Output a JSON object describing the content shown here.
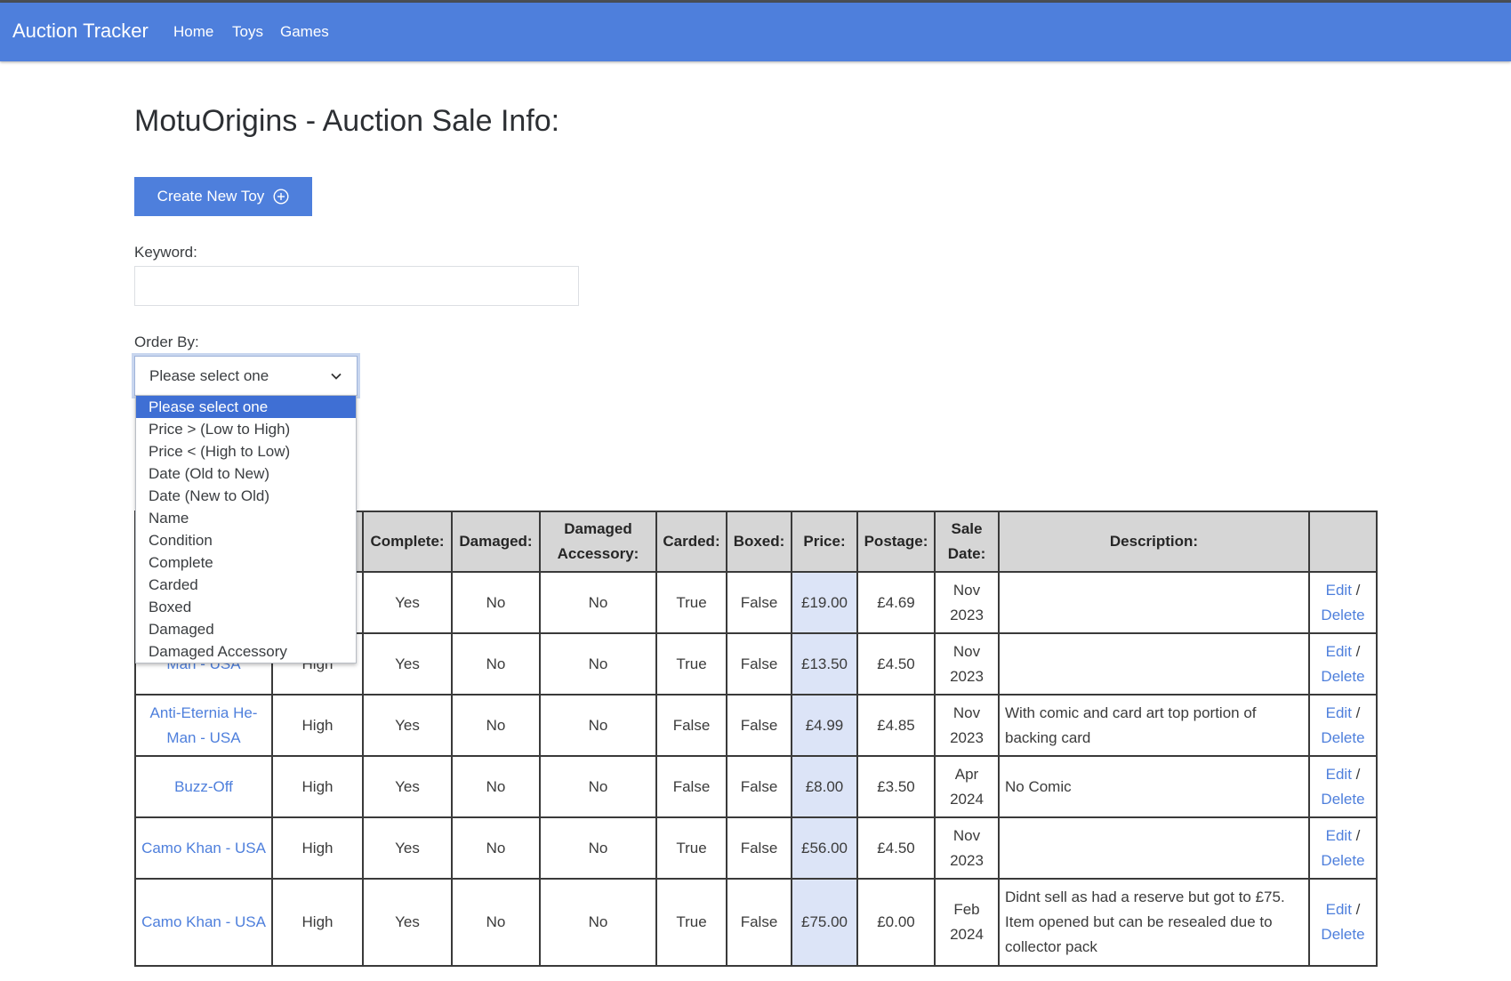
{
  "nav": {
    "brand": "Auction Tracker",
    "links": [
      "Home",
      "Toys",
      "Games"
    ]
  },
  "page": {
    "title": "MotuOrigins - Auction Sale Info:",
    "create_button": "Create New Toy",
    "keyword_label": "Keyword:",
    "keyword_value": "",
    "order_label": "Order By:",
    "order_selected": "Please select one"
  },
  "order_options": [
    "Please select one",
    "Price > (Low to High)",
    "Price < (High to Low)",
    "Date (Old to New)",
    "Date (New to Old)",
    "Name",
    "Condition",
    "Complete",
    "Carded",
    "Boxed",
    "Damaged",
    "Damaged Accessory"
  ],
  "table": {
    "headers": [
      "",
      "",
      "Complete:",
      "Damaged:",
      "Damaged Accessory:",
      "Carded:",
      "Boxed:",
      "Price:",
      "Postage:",
      "Sale Date:",
      "Description:",
      ""
    ],
    "rows": [
      {
        "name": "",
        "condition": "",
        "complete": "Yes",
        "damaged": "No",
        "damaged_accessory": "No",
        "carded": "True",
        "boxed": "False",
        "price": "£19.00",
        "postage": "£4.69",
        "sale_date": "Nov 2023",
        "description": "",
        "edit": "Edit",
        "delete": "Delete"
      },
      {
        "name": "Man - USA",
        "condition": "High",
        "complete": "Yes",
        "damaged": "No",
        "damaged_accessory": "No",
        "carded": "True",
        "boxed": "False",
        "price": "£13.50",
        "postage": "£4.50",
        "sale_date": "Nov 2023",
        "description": "",
        "edit": "Edit",
        "delete": "Delete"
      },
      {
        "name": "Anti-Eternia He-Man - USA",
        "condition": "High",
        "complete": "Yes",
        "damaged": "No",
        "damaged_accessory": "No",
        "carded": "False",
        "boxed": "False",
        "price": "£4.99",
        "postage": "£4.85",
        "sale_date": "Nov 2023",
        "description": "With comic and card art top portion of backing card",
        "edit": "Edit",
        "delete": "Delete"
      },
      {
        "name": "Buzz-Off",
        "condition": "High",
        "complete": "Yes",
        "damaged": "No",
        "damaged_accessory": "No",
        "carded": "False",
        "boxed": "False",
        "price": "£8.00",
        "postage": "£3.50",
        "sale_date": "Apr 2024",
        "description": "No Comic",
        "edit": "Edit",
        "delete": "Delete"
      },
      {
        "name": "Camo Khan - USA",
        "condition": "High",
        "complete": "Yes",
        "damaged": "No",
        "damaged_accessory": "No",
        "carded": "True",
        "boxed": "False",
        "price": "£56.00",
        "postage": "£4.50",
        "sale_date": "Nov 2023",
        "description": "",
        "edit": "Edit",
        "delete": "Delete"
      },
      {
        "name": "Camo Khan - USA",
        "condition": "High",
        "complete": "Yes",
        "damaged": "No",
        "damaged_accessory": "No",
        "carded": "True",
        "boxed": "False",
        "price": "£75.00",
        "postage": "£0.00",
        "sale_date": "Feb 2024",
        "description": "Didnt sell as had a reserve but got to £75. Item opened but can be resealed due to collector pack",
        "edit": "Edit",
        "delete": "Delete"
      }
    ]
  }
}
